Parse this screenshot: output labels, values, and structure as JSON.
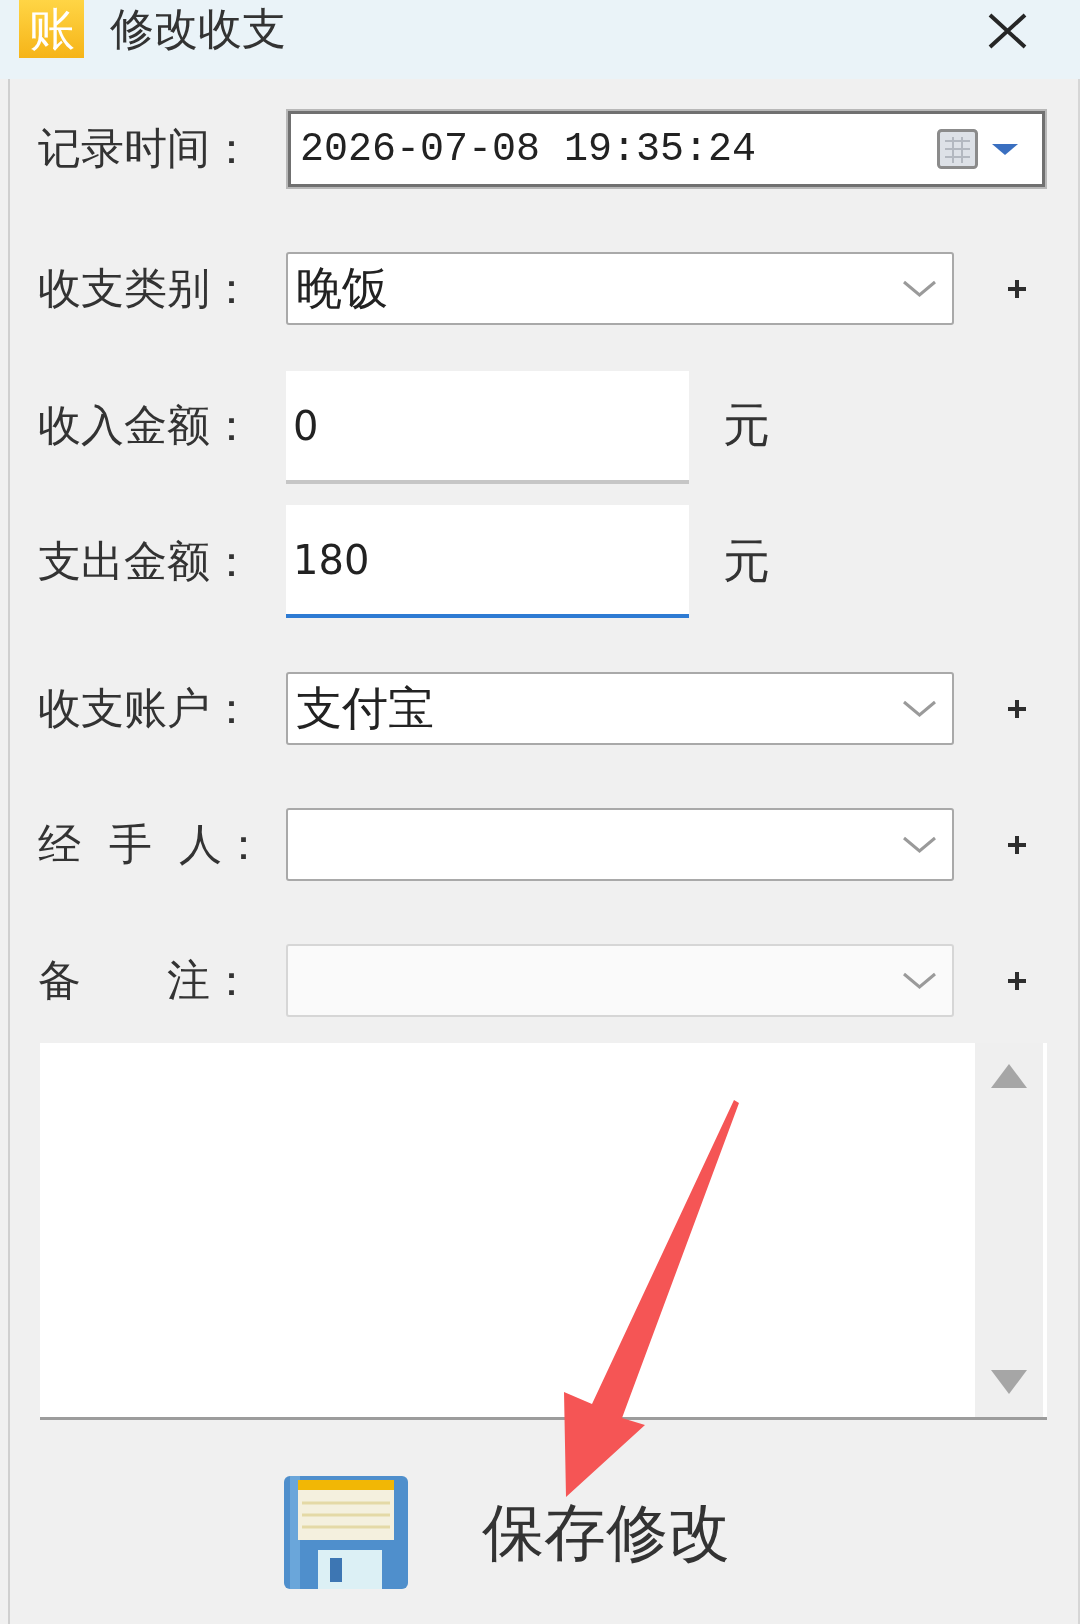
{
  "window": {
    "icon_text": "账",
    "title": "修改收支"
  },
  "fields": [
    {
      "kind": "datetime",
      "label": "记录时间：",
      "value": "2026-07-08 19:35:24"
    },
    {
      "kind": "dropdown",
      "label": "收支类别：",
      "value": "晚饭"
    },
    {
      "kind": "amount",
      "label": "收入金额：",
      "value": "0",
      "unit": "元",
      "focused": false
    },
    {
      "kind": "amount",
      "label": "支出金额：",
      "value": "180",
      "unit": "元",
      "focused": true
    },
    {
      "kind": "dropdown",
      "label": "收支账户：",
      "value": "支付宝"
    },
    {
      "kind": "dropdown",
      "label": "经 手 人："
    },
    {
      "kind": "combobox",
      "label": "备　　注："
    }
  ],
  "save_button": {
    "label": "保存修改"
  }
}
